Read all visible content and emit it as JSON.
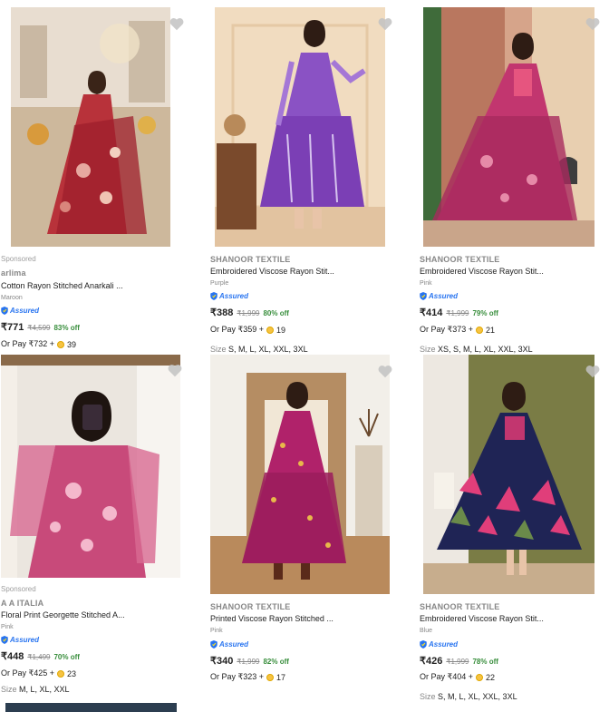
{
  "products": [
    {
      "sponsored": "Sponsored",
      "brand": "arlima",
      "title": "Cotton Rayon Stitched Anarkali ...",
      "color": "Maroon",
      "assured": "Assured",
      "price": "₹771",
      "mrp": "₹4,599",
      "off": "83% off",
      "or_pay": "Or Pay ₹732 +",
      "coins": "39",
      "sizes_label": "",
      "sizes": "",
      "image_icon": "maroon-floral-anarkali-photo"
    },
    {
      "sponsored": "",
      "brand": "SHANOOR TEXTILE",
      "title": "Embroidered Viscose Rayon Stit...",
      "color": "Purple",
      "assured": "Assured",
      "price": "₹388",
      "mrp": "₹1,999",
      "off": "80% off",
      "or_pay": "Or Pay ₹359 +",
      "coins": "19",
      "sizes_label": "Size",
      "sizes": "S, M, L, XL, XXL, 3XL",
      "image_icon": "purple-tiered-anarkali-photo"
    },
    {
      "sponsored": "",
      "brand": "SHANOOR TEXTILE",
      "title": "Embroidered Viscose Rayon Stit...",
      "color": "Pink",
      "assured": "Assured",
      "price": "₹414",
      "mrp": "₹1,999",
      "off": "79% off",
      "or_pay": "Or Pay ₹373 +",
      "coins": "21",
      "sizes_label": "Size",
      "sizes": "XS, S, M, L, XL, XXL, 3XL",
      "image_icon": "pink-anarkali-photo"
    },
    {
      "sponsored": "Sponsored",
      "brand": "A A ITALIA",
      "title": "Floral Print Georgette Stitched A...",
      "color": "Pink",
      "assured": "Assured",
      "price": "₹448",
      "mrp": "₹1,499",
      "off": "70% off",
      "or_pay": "Or Pay ₹425 +",
      "coins": "23",
      "sizes_label": "Size",
      "sizes": "M, L, XL, XXL",
      "image_icon": "pink-georgette-mirror-selfie-photo"
    },
    {
      "sponsored": "",
      "brand": "SHANOOR TEXTILE",
      "title": "Printed Viscose Rayon Stitched ...",
      "color": "Pink",
      "assured": "Assured",
      "price": "₹340",
      "mrp": "₹1,999",
      "off": "82% off",
      "or_pay": "Or Pay ₹323 +",
      "coins": "17",
      "sizes_label": "",
      "sizes": "",
      "image_icon": "magenta-printed-anarkali-photo"
    },
    {
      "sponsored": "",
      "brand": "SHANOOR TEXTILE",
      "title": "Embroidered Viscose Rayon Stit...",
      "color": "Blue",
      "assured": "Assured",
      "price": "₹426",
      "mrp": "₹1,999",
      "off": "78% off",
      "or_pay": "Or Pay ₹404 +",
      "coins": "22",
      "sizes_label": "Size",
      "sizes": "S, M, L, XL, XXL, 3XL",
      "image_icon": "navy-floral-anarkali-photo"
    }
  ],
  "colors": {
    "assured_blue": "#2874f0",
    "discount_green": "#388e3c",
    "muted_text": "#878787",
    "coin_gold": "#f6c343"
  }
}
